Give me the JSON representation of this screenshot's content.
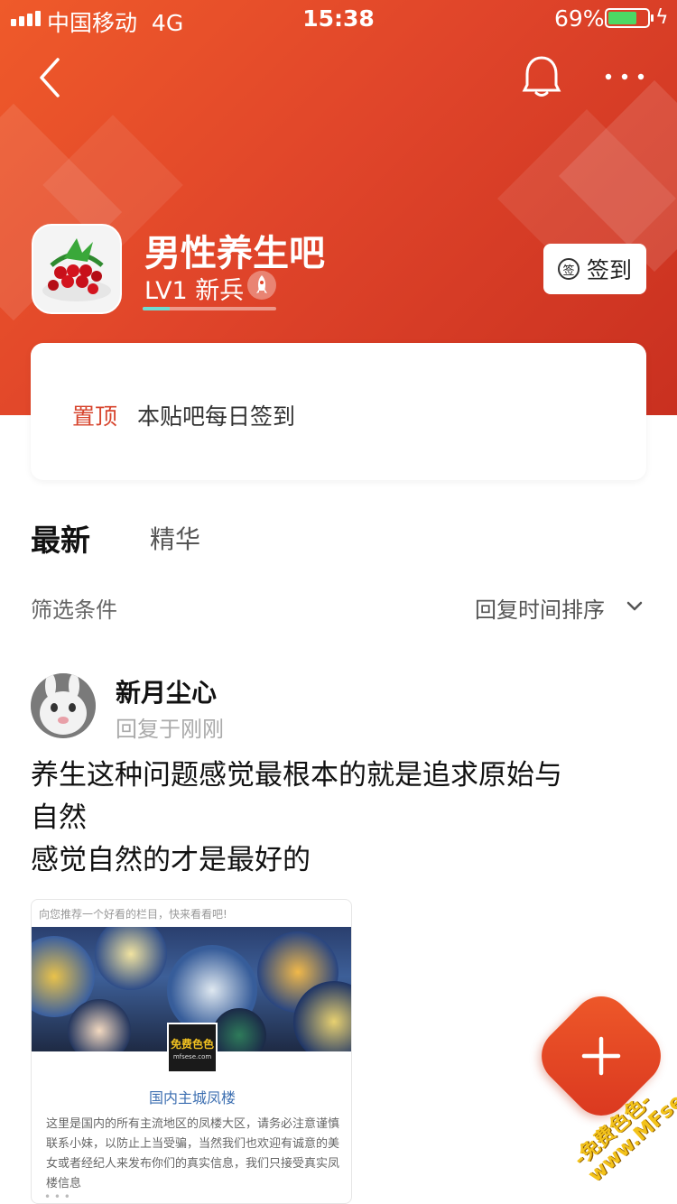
{
  "status_bar": {
    "carrier": "中国移动",
    "network": "4G",
    "time": "15:38",
    "battery": "69%",
    "battery_level": 0.69
  },
  "nav": {
    "back_icon": "chevron-left-icon",
    "bell_icon": "bell-icon",
    "more_icon": "more-dots-icon"
  },
  "forum": {
    "title": "男性养生吧",
    "level": "LV1 新兵",
    "level_progress": 0.2,
    "checkin_icon_glyph": "签",
    "checkin_label": "签到"
  },
  "pinned": {
    "tag": "置顶",
    "text": "本贴吧每日签到"
  },
  "tabs": {
    "latest": "最新",
    "featured": "精华"
  },
  "filters": {
    "label": "筛选条件",
    "sort": "回复时间排序"
  },
  "post": {
    "author": "新月尘心",
    "meta": "回复于刚刚",
    "body_lines": [
      "养生这种问题感觉最根本的就是追求原始与",
      "自然",
      "感觉自然的才是最好的"
    ],
    "share": {
      "header": "向您推荐一个好看的栏目，快来看看吧!",
      "logo_text": "免费色色",
      "logo_sub": "mfsese.com",
      "title": "国内主城凤楼",
      "description": "这里是国内的所有主流地区的凤楼大区，请务必注意谨慎联系小妹，以防止上当受骗，当然我们也欢迎有诚意的美女或者经纪人来发布你们的真实信息，我们只接受真实凤楼信息",
      "dots": "• • •"
    }
  },
  "fab": {
    "icon": "plus-icon"
  },
  "watermark": {
    "line1": "-免费色色-",
    "line2": "www.MFsese.com"
  },
  "colors": {
    "accent": "#e0452a",
    "pin_tag": "#d7442d",
    "link_blue": "#3d6fb1"
  }
}
